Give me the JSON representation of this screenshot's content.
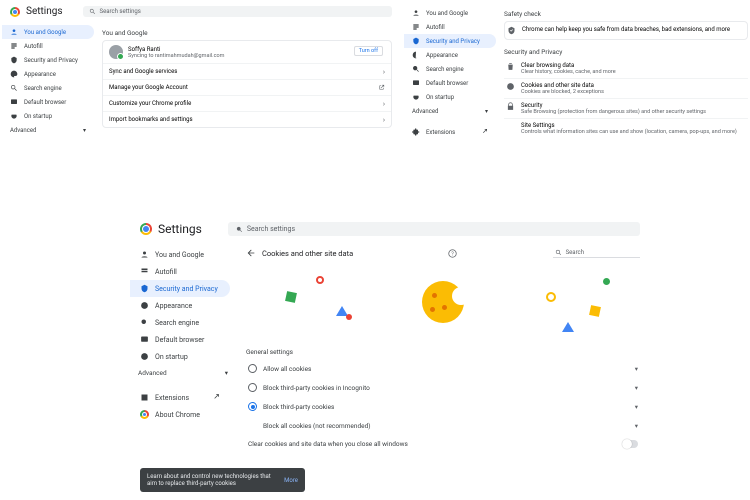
{
  "common": {
    "title": "Settings",
    "search_ph": "Search settings",
    "advanced": "Advanced"
  },
  "nav": {
    "you": "You and Google",
    "autofill": "Autofill",
    "security": "Security and Privacy",
    "appearance": "Appearance",
    "search": "Search engine",
    "browser": "Default browser",
    "startup": "On startup",
    "ext": "Extensions",
    "about": "About Chrome"
  },
  "p1": {
    "section": "You and Google",
    "name": "Soffya Ranti",
    "email": "Syncing to rantimahmudah@gmail.com",
    "turn_off": "Turn off",
    "r1": "Sync and Google services",
    "r2": "Manage your Google Account",
    "r3": "Customize your Chrome profile",
    "r4": "Import bookmarks and settings"
  },
  "p2": {
    "safety": "Safety check",
    "safety_desc": "Chrome can help keep you safe from data breaches, bad extensions, and more",
    "sp": "Security and Privacy",
    "i1t": "Clear browsing data",
    "i1s": "Clear history, cookies, cache, and more",
    "i2t": "Cookies and other site data",
    "i2s": "Cookies are blocked, 2 exceptions",
    "i3t": "Security",
    "i3s": "Safe Browsing (protection from dangerous sites) and other security settings",
    "i4t": "Site Settings",
    "i4s": "Controls what information sites can use and show (location, camera, pop-ups, and more)"
  },
  "p3": {
    "page": "Cookies and other site data",
    "srch": "Search",
    "gen": "General settings",
    "o1": "Allow all cookies",
    "o2": "Block third-party cookies in Incognito",
    "o3": "Block third-party cookies",
    "o4": "Block all cookies (not recommended)",
    "clr": "Clear cookies and site data when you close all windows",
    "toast": "Learn about and control new technologies that aim to replace third-party cookies",
    "more": "More"
  }
}
